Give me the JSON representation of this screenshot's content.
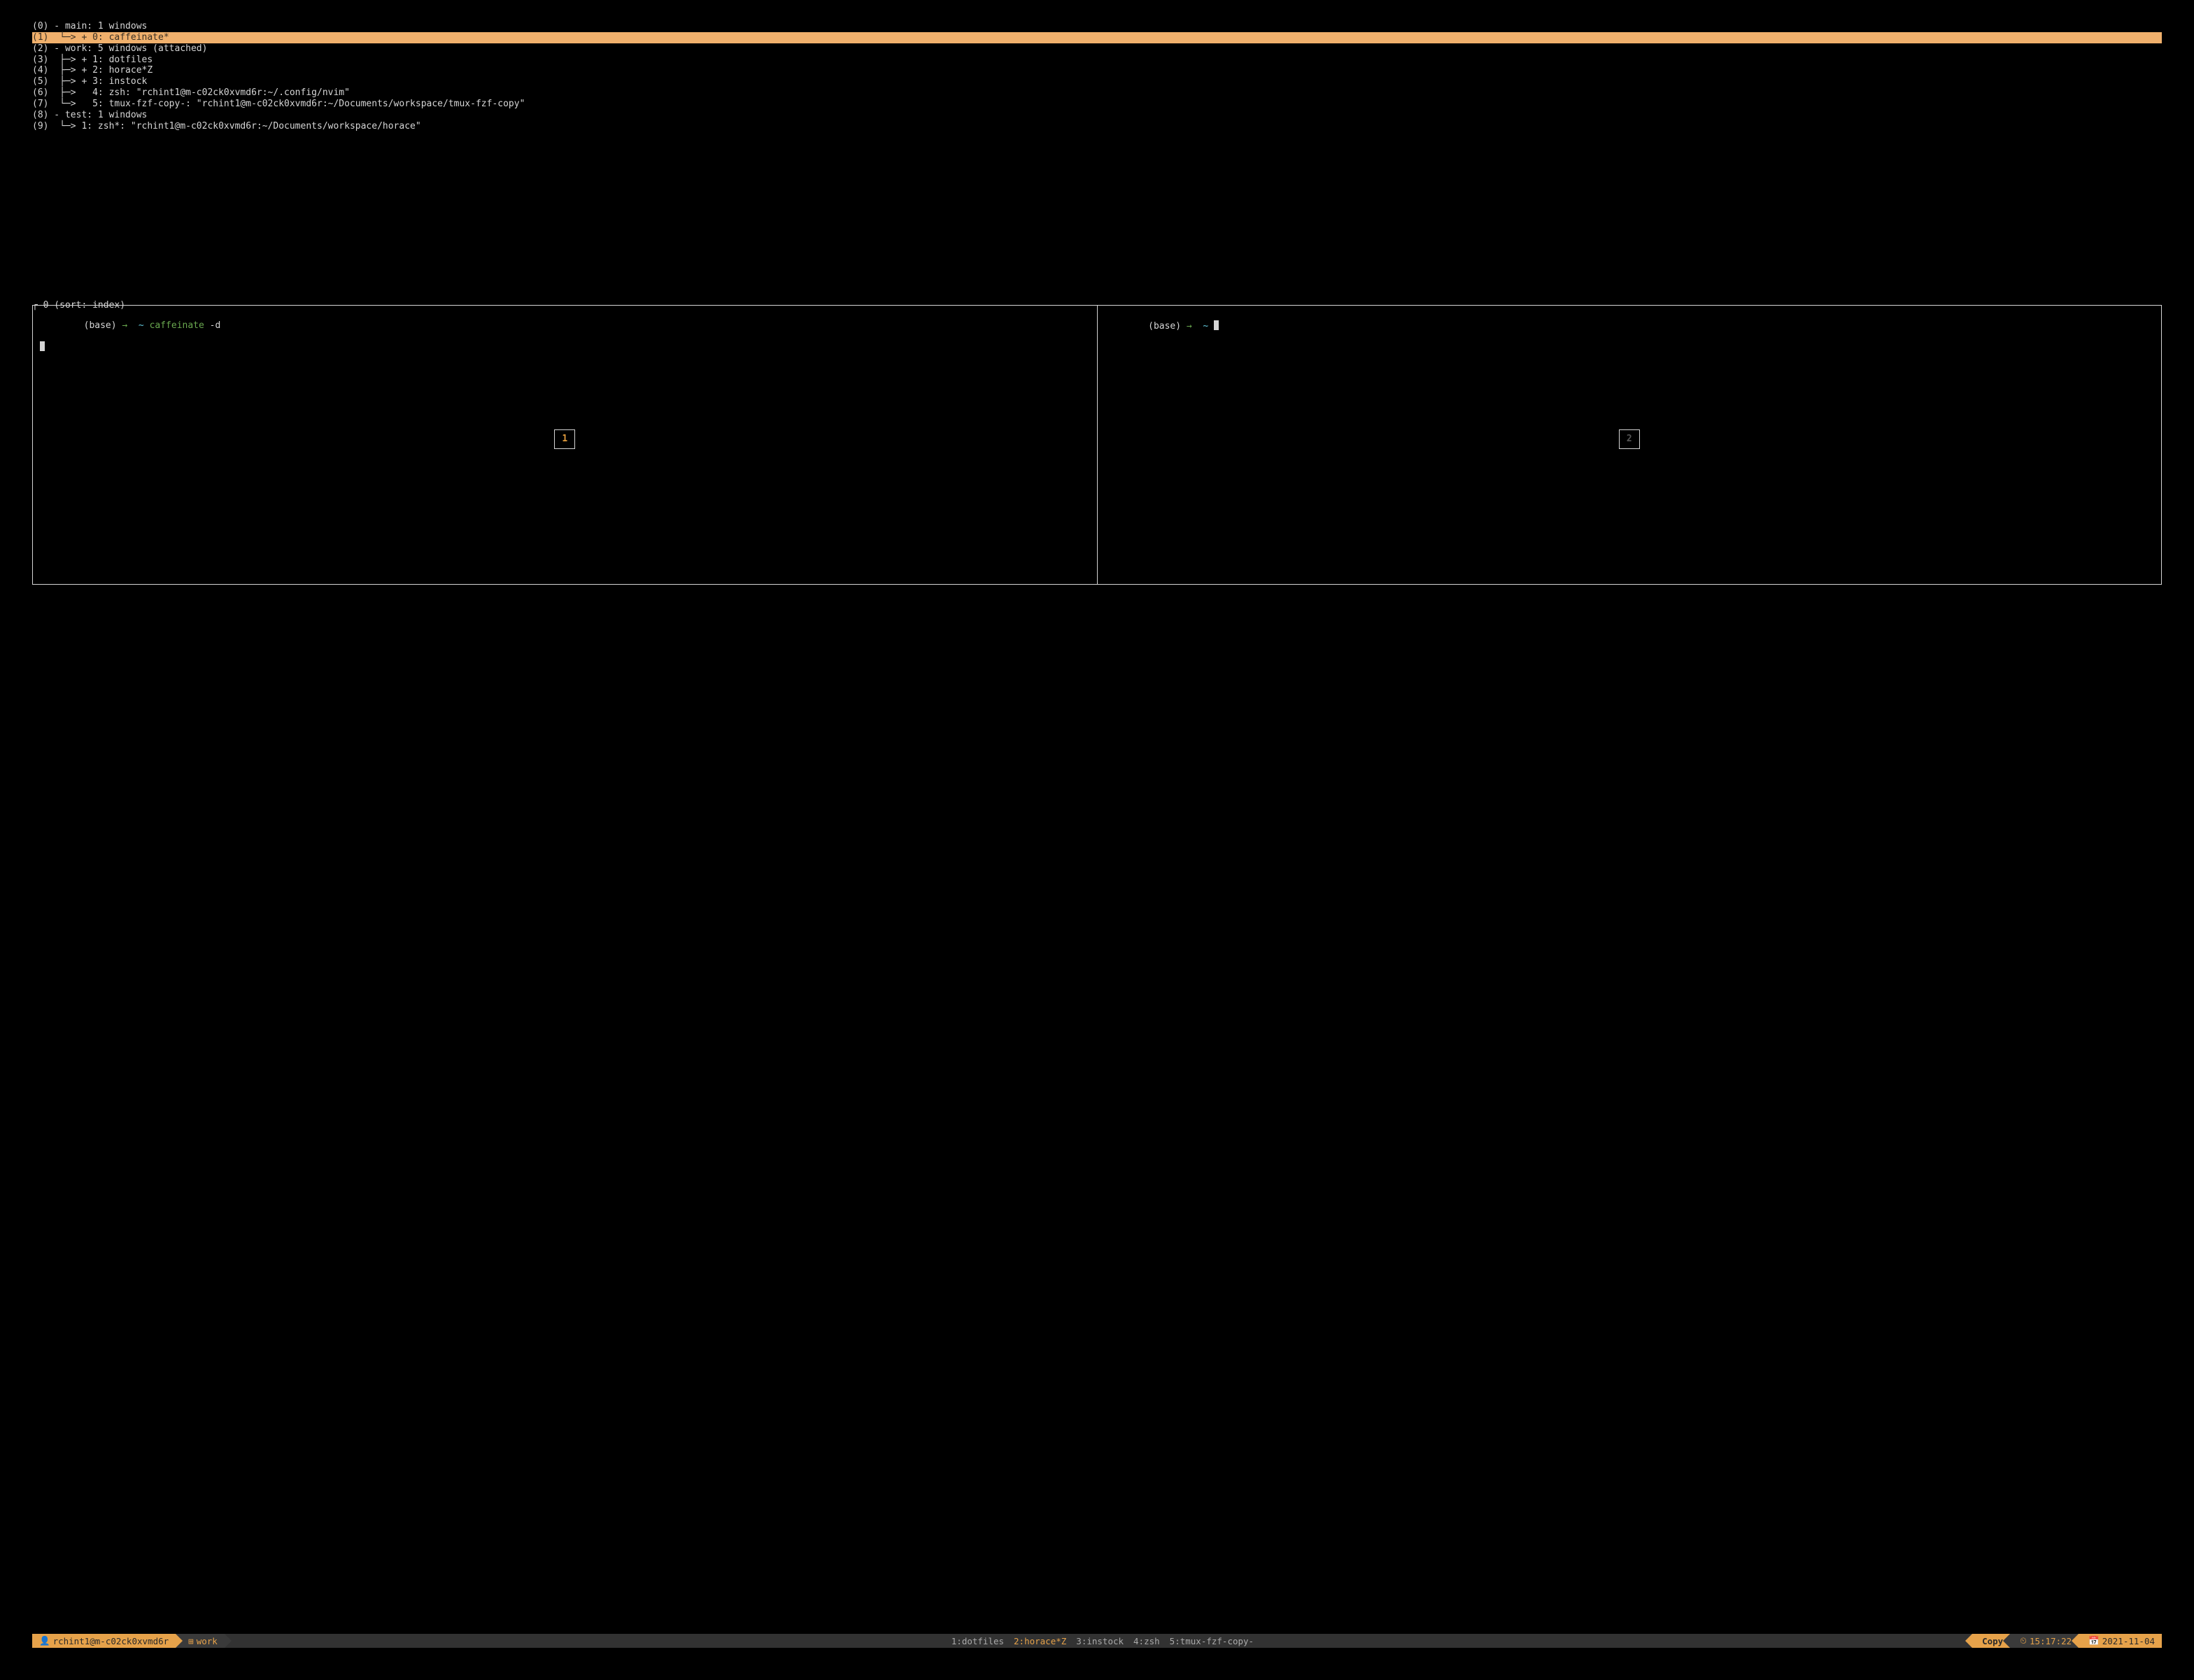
{
  "tree": [
    {
      "idx": "(0)",
      "text": " - main: 1 windows",
      "selected": false
    },
    {
      "idx": "(1)",
      "text": "  └─> + 0: caffeinate*",
      "selected": true
    },
    {
      "idx": "(2)",
      "text": " - work: 5 windows (attached)",
      "selected": false
    },
    {
      "idx": "(3)",
      "text": "  ├─> + 1: dotfiles",
      "selected": false
    },
    {
      "idx": "(4)",
      "text": "  ├─> + 2: horace*Z",
      "selected": false
    },
    {
      "idx": "(5)",
      "text": "  ├─> + 3: instock",
      "selected": false
    },
    {
      "idx": "(6)",
      "text": "  ├─>   4: zsh: \"rchint1@m-c02ck0xvmd6r:~/.config/nvim\"",
      "selected": false
    },
    {
      "idx": "(7)",
      "text": "  └─>   5: tmux-fzf-copy-: \"rchint1@m-c02ck0xvmd6r:~/Documents/workspace/tmux-fzf-copy\"",
      "selected": false
    },
    {
      "idx": "(8)",
      "text": " - test: 1 windows",
      "selected": false
    },
    {
      "idx": "(9)",
      "text": "  └─> 1: zsh*: \"rchint1@m-c02ck0xvmd6r:~/Documents/workspace/horace\"",
      "selected": false
    }
  ],
  "preview": {
    "header": "┌ 0 (sort: index) ",
    "left": {
      "base": "(base)",
      "arrow": "→",
      "tilde": "~",
      "cmd": "caffeinate",
      "arg": "-d",
      "badge": "1"
    },
    "right": {
      "base": "(base)",
      "arrow": "→",
      "tilde": "~",
      "badge": "2"
    }
  },
  "status": {
    "user_icon": "👤",
    "host": "rchint1@m-c02ck0xvmd6r",
    "session_icon": "⊞",
    "session": "work",
    "windows": [
      {
        "label": "1:dotfiles",
        "active": false
      },
      {
        "label": "2:horace*Z",
        "active": true
      },
      {
        "label": "3:instock",
        "active": false
      },
      {
        "label": "4:zsh",
        "active": false
      },
      {
        "label": "5:tmux-fzf-copy-",
        "active": false
      }
    ],
    "mode": "Copy",
    "clock_icon": "⏲",
    "time": "15:17:22",
    "cal_icon": "📅",
    "date": "2021-11-04"
  }
}
